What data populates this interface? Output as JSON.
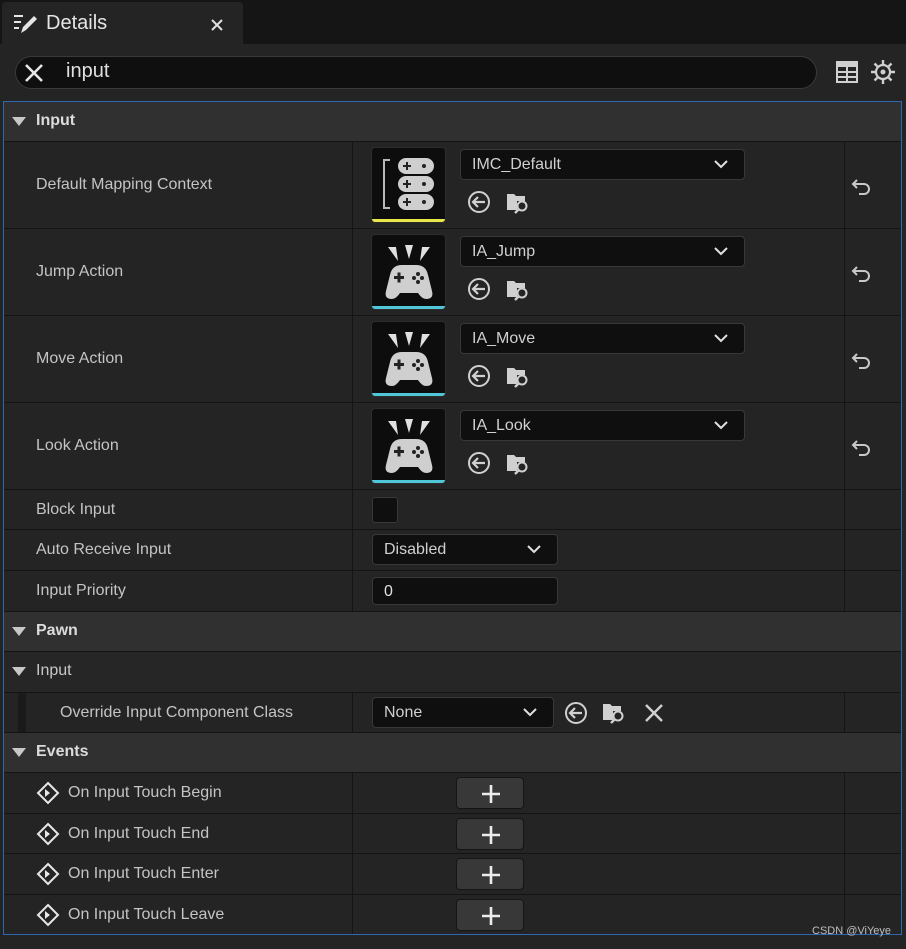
{
  "tab": {
    "title": "Details"
  },
  "search": {
    "value": "input"
  },
  "categories": {
    "input": "Input",
    "pawn": "Pawn",
    "pawn_input": "Input",
    "events": "Events"
  },
  "assets": [
    {
      "label": "Default Mapping Context",
      "value": "IMC_Default",
      "accent": "#e8e84a",
      "icon": "mapping-context-icon"
    },
    {
      "label": "Jump Action",
      "value": "IA_Jump",
      "accent": "#4fc7d8",
      "icon": "input-action-icon"
    },
    {
      "label": "Move Action",
      "value": "IA_Move",
      "accent": "#4fc7d8",
      "icon": "input-action-icon"
    },
    {
      "label": "Look Action",
      "value": "IA_Look",
      "accent": "#4fc7d8",
      "icon": "input-action-icon"
    }
  ],
  "properties": {
    "block_input": {
      "label": "Block Input",
      "checked": false
    },
    "auto_receive": {
      "label": "Auto Receive Input",
      "value": "Disabled"
    },
    "input_priority": {
      "label": "Input Priority",
      "value": "0"
    },
    "override_class": {
      "label": "Override Input Component Class",
      "value": "None"
    }
  },
  "events": [
    {
      "label": "On Input Touch Begin"
    },
    {
      "label": "On Input Touch End"
    },
    {
      "label": "On Input Touch Enter"
    },
    {
      "label": "On Input Touch Leave"
    }
  ],
  "colors": {
    "selection_border": "#2f67b0",
    "panel": "#242424",
    "field": "#0f0f0f"
  },
  "watermark": "CSDN @ViYeye"
}
